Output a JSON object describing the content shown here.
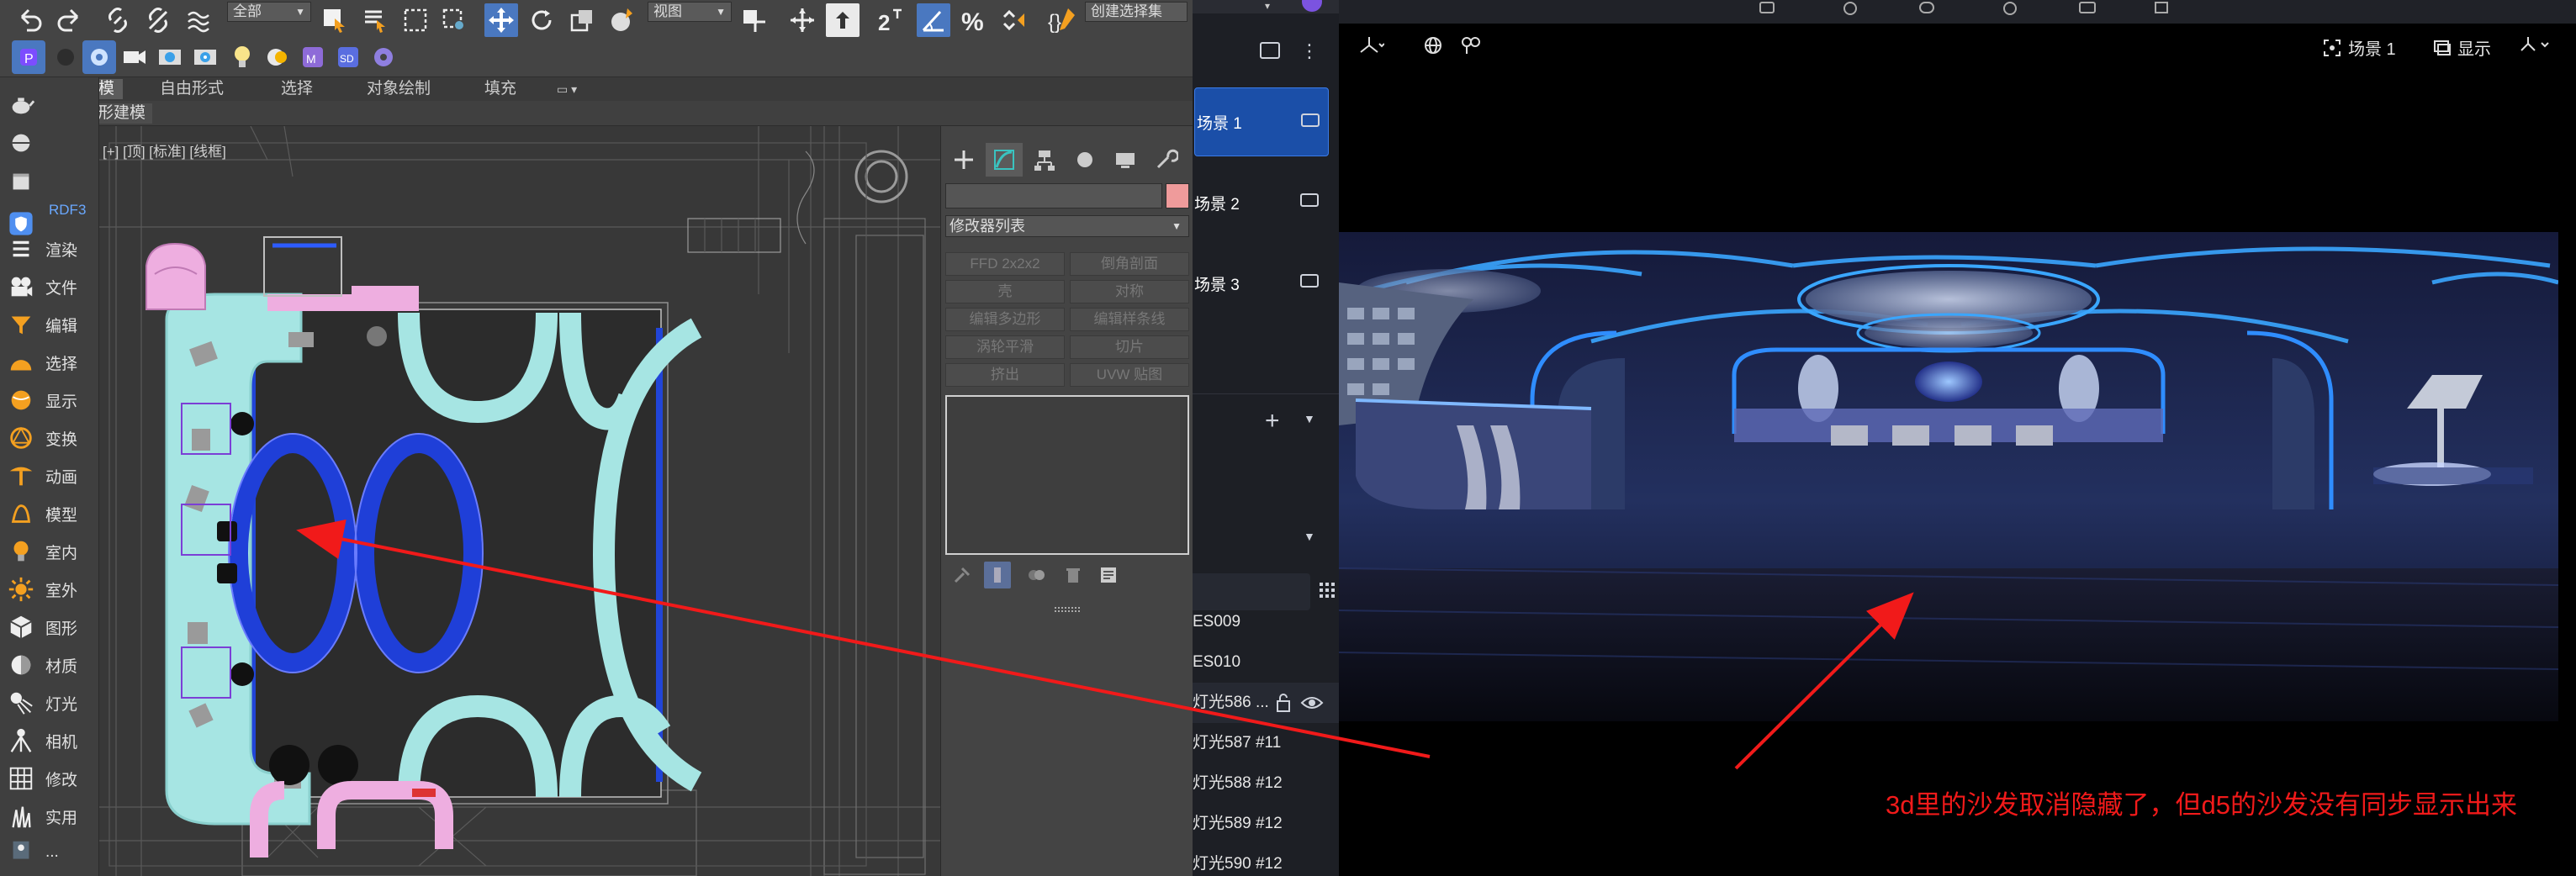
{
  "max": {
    "toolbar": {
      "selection_filter": "全部",
      "ref_coord": "视图",
      "selection_set": "创建选择集"
    },
    "ribbon": {
      "tabs": [
        "建模",
        "自由形式",
        "选择",
        "对象绘制",
        "填充"
      ],
      "active_tab": "建模",
      "sub_label": "多边形建模"
    },
    "command_panel": {
      "header": "RDF3",
      "items": [
        "渲染",
        "文件",
        "编辑",
        "选择",
        "显示",
        "变换",
        "动画",
        "模型",
        "室内",
        "室外",
        "图形",
        "材质",
        "灯光",
        "相机",
        "修改",
        "实用",
        "..."
      ]
    },
    "viewport": {
      "label": "[+] [顶] [标准] [线框]"
    },
    "modify_panel": {
      "modifier_list": "修改器列表",
      "buttons": [
        "FFD 2x2x2",
        "倒角剖面",
        "壳",
        "对称",
        "编辑多边形",
        "编辑样条线",
        "涡轮平滑",
        "切片",
        "挤出",
        "UVW 贴图"
      ]
    }
  },
  "d5": {
    "scenes": [
      "场景 1",
      "场景 2",
      "场景 3"
    ],
    "active_scene": "场景 1",
    "list_items": [
      "ES009",
      "ES010",
      "灯光586 ...",
      "灯光587 #11",
      "灯光588 #12",
      "灯光589 #12",
      "灯光590 #12"
    ],
    "topbar": {
      "scene_label": "场景 1",
      "display_label": "显示"
    }
  },
  "annotation": {
    "text": "3d里的沙发取消隐藏了，但d5的沙发没有同步显示出来",
    "color": "#f11a1a"
  },
  "colors": {
    "max_bg": "#444444",
    "d5_bg": "#1d1f25",
    "d5_accent": "#1b4fa8",
    "sofa_cyan": "#a6e5e3",
    "table_blue": "#1f3fd8",
    "chair_pink": "#eeaee0"
  }
}
